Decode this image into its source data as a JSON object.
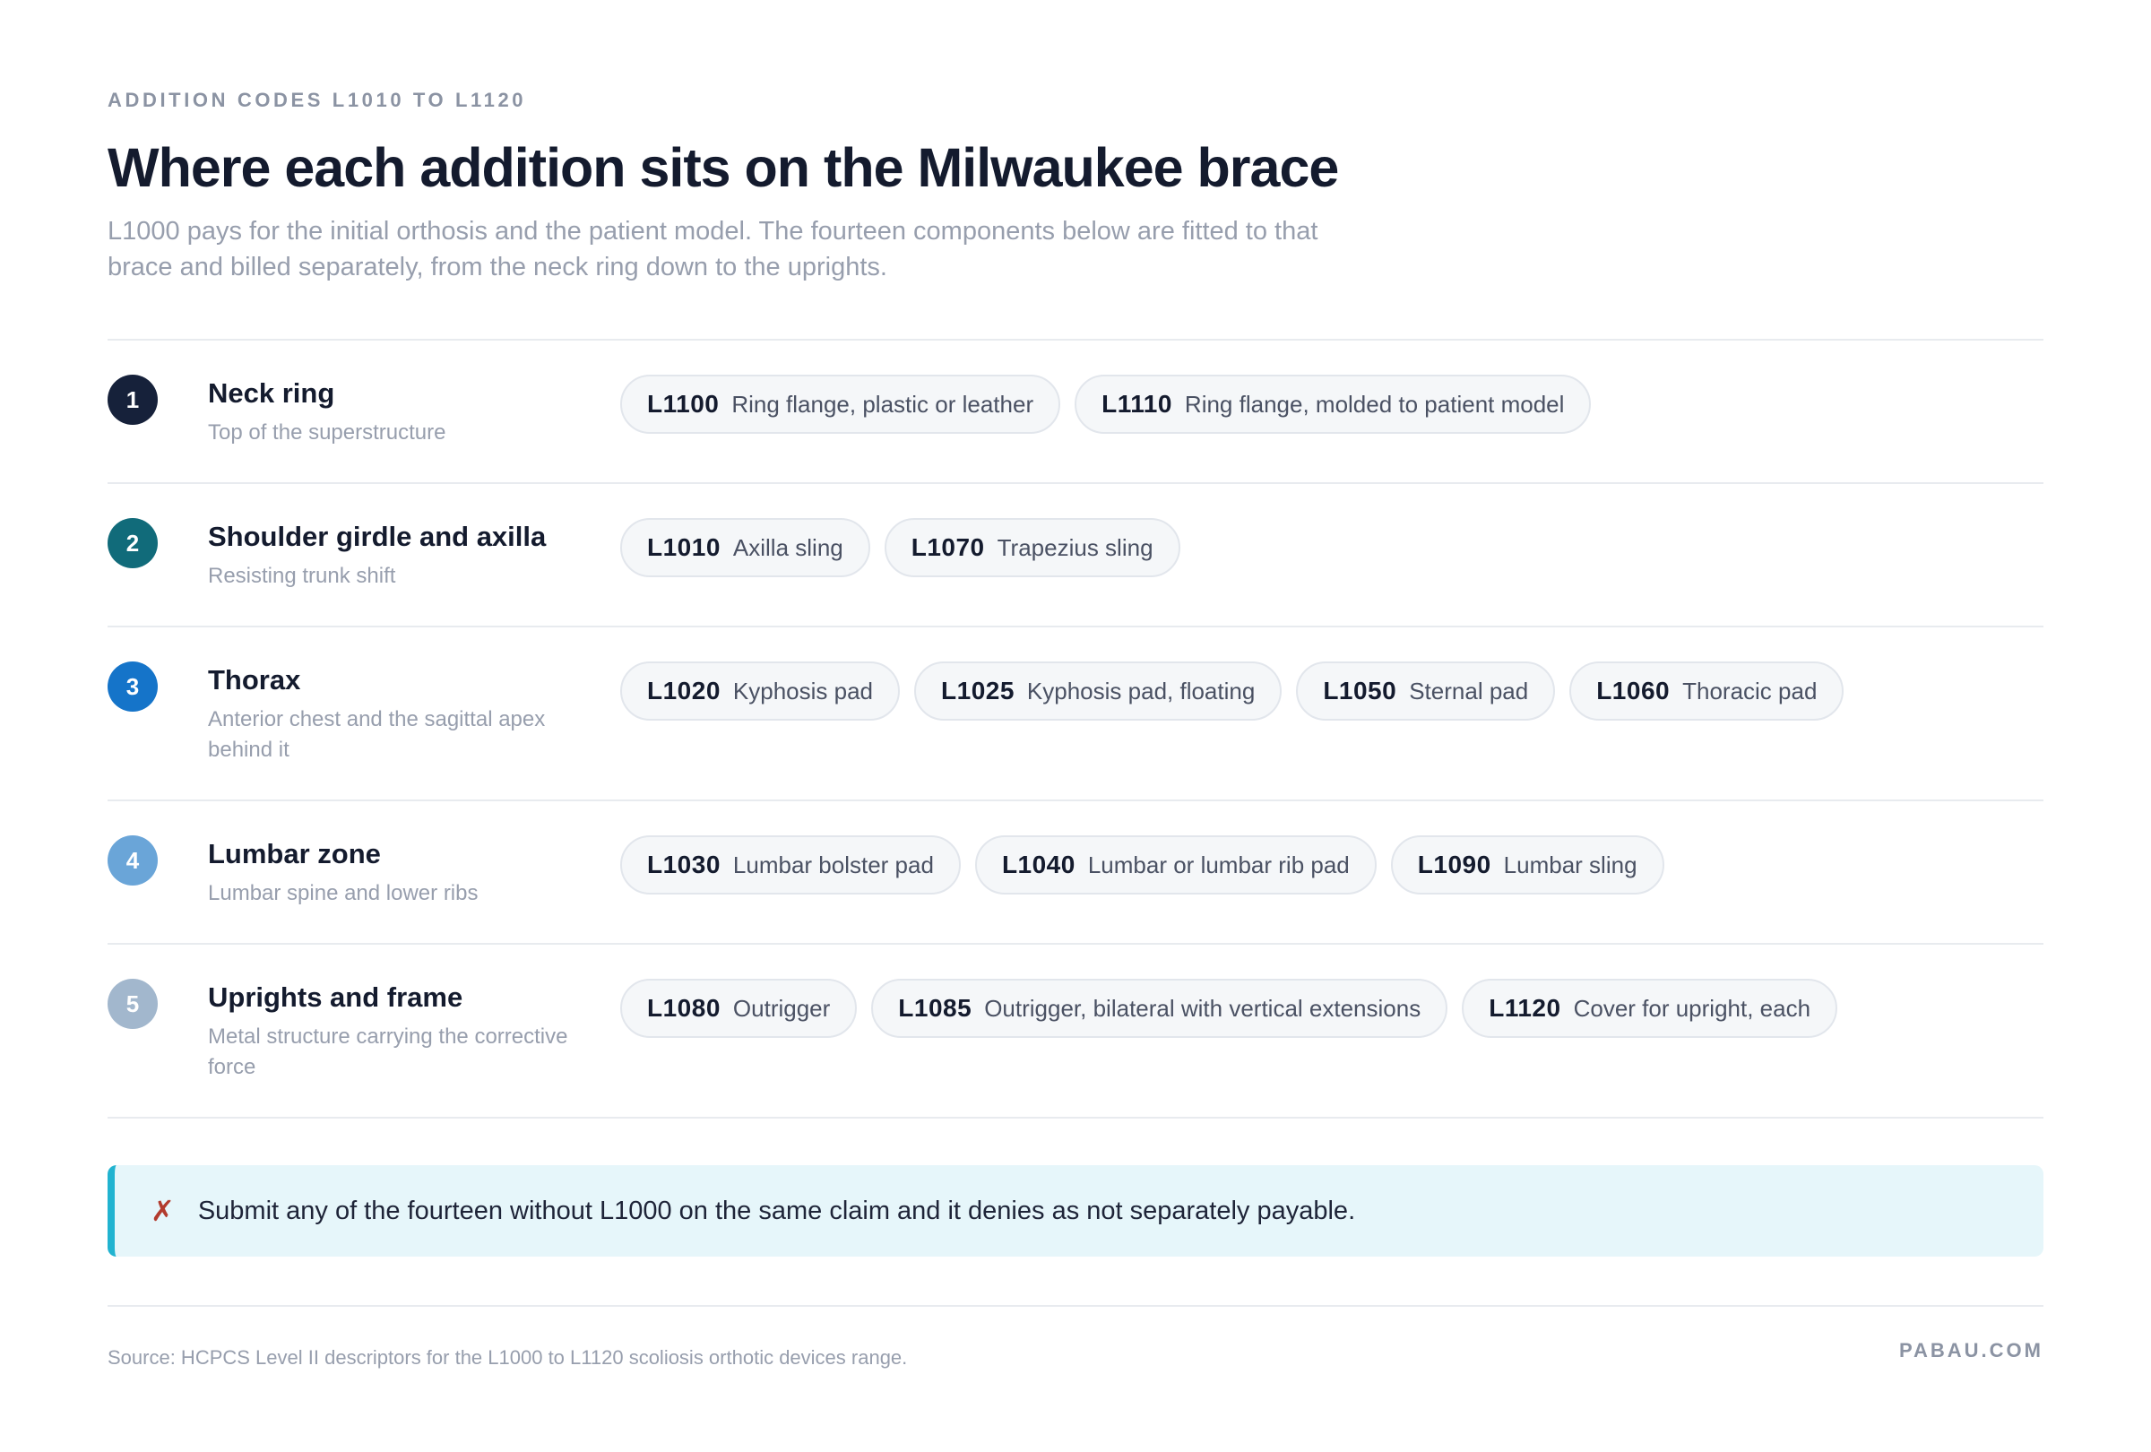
{
  "header": {
    "eyebrow": "ADDITION CODES L1010 TO L1120",
    "title": "Where each addition sits on the Milwaukee brace",
    "subtitle": "L1000 pays for the initial orthosis and the patient model. The fourteen components below are fitted to that brace and billed separately, from the neck ring down to the uprights."
  },
  "rows": [
    {
      "number": "1",
      "color": "#16213a",
      "name": "Neck ring",
      "description": "Top of the superstructure",
      "codes": [
        {
          "code": "L1100",
          "label": "Ring flange, plastic or leather"
        },
        {
          "code": "L1110",
          "label": "Ring flange, molded to patient model"
        }
      ]
    },
    {
      "number": "2",
      "color": "#116b7a",
      "name": "Shoulder girdle and axilla",
      "description": "Resisting trunk shift",
      "codes": [
        {
          "code": "L1010",
          "label": "Axilla sling"
        },
        {
          "code": "L1070",
          "label": "Trapezius sling"
        }
      ]
    },
    {
      "number": "3",
      "color": "#1574c9",
      "name": "Thorax",
      "description": "Anterior chest and the sagittal apex behind it",
      "codes": [
        {
          "code": "L1020",
          "label": "Kyphosis pad"
        },
        {
          "code": "L1025",
          "label": "Kyphosis pad, floating"
        },
        {
          "code": "L1050",
          "label": "Sternal pad"
        },
        {
          "code": "L1060",
          "label": "Thoracic pad"
        }
      ]
    },
    {
      "number": "4",
      "color": "#6aa5d8",
      "name": "Lumbar zone",
      "description": "Lumbar spine and lower ribs",
      "codes": [
        {
          "code": "L1030",
          "label": "Lumbar bolster pad"
        },
        {
          "code": "L1040",
          "label": "Lumbar or lumbar rib pad"
        },
        {
          "code": "L1090",
          "label": "Lumbar sling"
        }
      ]
    },
    {
      "number": "5",
      "color": "#a2b7cd",
      "name": "Uprights and frame",
      "description": "Metal structure carrying the corrective force",
      "codes": [
        {
          "code": "L1080",
          "label": "Outrigger"
        },
        {
          "code": "L1085",
          "label": "Outrigger, bilateral with vertical extensions"
        },
        {
          "code": "L1120",
          "label": "Cover for upright, each"
        }
      ]
    }
  ],
  "callout": {
    "icon": "cross-icon",
    "glyph": "✗",
    "text": "Submit any of the fourteen without L1000 on the same claim and it denies as not separately payable."
  },
  "footer": {
    "source": "Source: HCPCS Level II descriptors for the L1000 to L1120 scoliosis orthotic devices range.",
    "brand": "PABAU.COM"
  }
}
